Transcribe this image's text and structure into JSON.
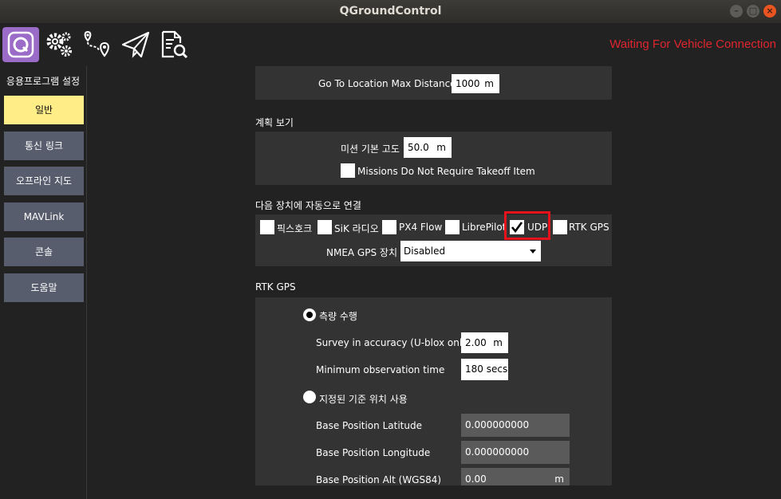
{
  "window": {
    "title": "QGroundControl"
  },
  "toolbar": {
    "icons": [
      "qgc-logo-icon",
      "gears-icon",
      "plan-waypoint-icon",
      "fly-paper-plane-icon",
      "analyze-document-icon"
    ],
    "status": "Waiting For Vehicle Connection",
    "status_color": "#e0252f"
  },
  "sidebar": {
    "title": "응용프로그램 설정",
    "items": [
      {
        "label": "일반",
        "selected": true
      },
      {
        "label": "통신 링크"
      },
      {
        "label": "오프라인 지도"
      },
      {
        "label": "MAVLink"
      },
      {
        "label": "콘솔"
      },
      {
        "label": "도움말"
      }
    ]
  },
  "settings": {
    "goto": {
      "label": "Go To Location Max Distance",
      "value": "1000",
      "unit": "m"
    },
    "plan_view": {
      "title": "계획 보기",
      "default_alt": {
        "label": "미션 기본 고도",
        "value": "50.0",
        "unit": "m"
      },
      "takeoff": {
        "label": "Missions Do Not Require Takeoff Item",
        "checked": false
      }
    },
    "autoconnect": {
      "title": "다음 장치에 자동으로 연결",
      "devices": [
        {
          "label": "픽스호크",
          "checked": false
        },
        {
          "label": "SiK 라디오",
          "checked": false
        },
        {
          "label": "PX4 Flow",
          "checked": false
        },
        {
          "label": "LibrePilot",
          "checked": false
        },
        {
          "label": "UDP",
          "checked": true
        },
        {
          "label": "RTK GPS",
          "checked": false
        }
      ],
      "nmea": {
        "label": "NMEA GPS 장치",
        "value": "Disabled"
      }
    },
    "rtk": {
      "title": "RTK GPS",
      "survey": {
        "label": "측량 수행",
        "selected": true
      },
      "accuracy": {
        "label": "Survey in accuracy (U-blox only)",
        "value": "2.00",
        "unit": "m"
      },
      "min_obs": {
        "label": "Minimum observation time",
        "value": "180 secs"
      },
      "fixed": {
        "label": "지정된 기준 위치 사용",
        "selected": false
      },
      "lat": {
        "label": "Base Position Latitude",
        "value": "0.000000000"
      },
      "lon": {
        "label": "Base Position Longitude",
        "value": "0.000000000"
      },
      "alt": {
        "label": "Base Position Alt (WGS84)",
        "value": "0.00",
        "unit": "m"
      }
    }
  }
}
